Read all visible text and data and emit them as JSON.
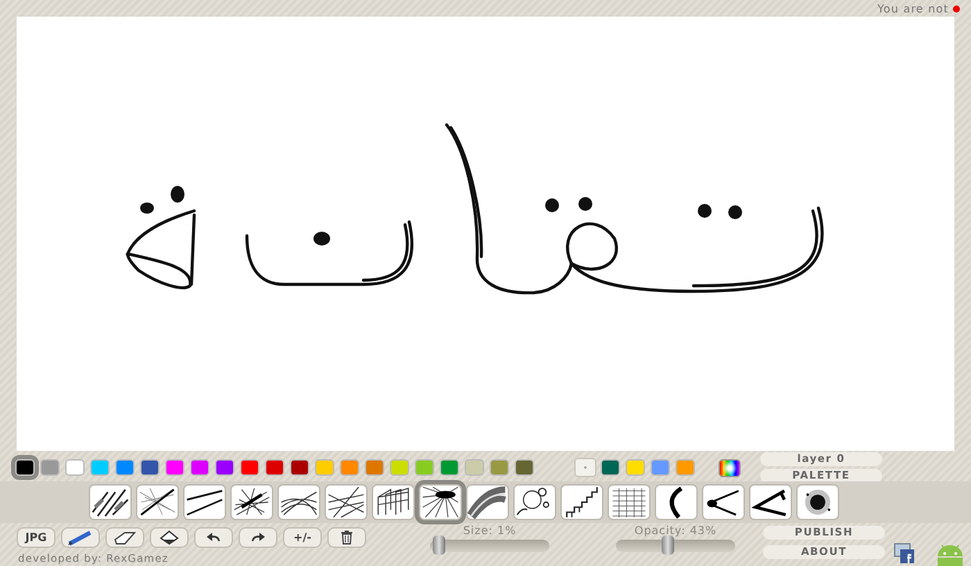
{
  "status": {
    "text": "You are not",
    "signed_in": false
  },
  "palette": {
    "colors": [
      {
        "color": "#000000",
        "selected": true
      },
      {
        "color": "#999999",
        "selected": false
      },
      {
        "color": "#ffffff",
        "selected": false
      },
      {
        "color": "#00ccff",
        "selected": false
      },
      {
        "color": "#0088ff",
        "selected": false
      },
      {
        "color": "#3355aa",
        "selected": false
      },
      {
        "color": "#ff00ff",
        "selected": false
      },
      {
        "color": "#dd00ff",
        "selected": false
      },
      {
        "color": "#9900ff",
        "selected": false
      },
      {
        "color": "#ff0000",
        "selected": false
      },
      {
        "color": "#dd0000",
        "selected": false
      },
      {
        "color": "#aa0000",
        "selected": false
      },
      {
        "color": "#ffcc00",
        "selected": false
      },
      {
        "color": "#ff8800",
        "selected": false
      },
      {
        "color": "#dd7700",
        "selected": false
      },
      {
        "color": "#ccdd00",
        "selected": false
      },
      {
        "color": "#88cc22",
        "selected": false
      },
      {
        "color": "#009933",
        "selected": false
      },
      {
        "color": "#ccccaa",
        "selected": false
      },
      {
        "color": "#999944",
        "selected": false
      },
      {
        "color": "#666633",
        "selected": false
      }
    ],
    "recent_colors": [
      {
        "color": "#006655",
        "selected": false
      },
      {
        "color": "#ffdd00",
        "selected": false
      },
      {
        "color": "#6699ff",
        "selected": false
      },
      {
        "color": "#ff9900",
        "selected": false
      }
    ],
    "layer_button": "layer 0",
    "palette_button": "PALETTE"
  },
  "brushes": [
    {
      "kind": "hatch",
      "selected": false
    },
    {
      "kind": "sketchy",
      "selected": false
    },
    {
      "kind": "lines",
      "selected": false
    },
    {
      "kind": "fur",
      "selected": false
    },
    {
      "kind": "curves",
      "selected": false
    },
    {
      "kind": "web",
      "selected": false
    },
    {
      "kind": "cube",
      "selected": false
    },
    {
      "kind": "radial",
      "selected": true
    },
    {
      "kind": "ribbon",
      "selected": false
    },
    {
      "kind": "circles",
      "selected": false
    },
    {
      "kind": "stairs",
      "selected": false
    },
    {
      "kind": "grid",
      "selected": false
    },
    {
      "kind": "crescent",
      "selected": false
    },
    {
      "kind": "spike",
      "selected": false
    },
    {
      "kind": "chevron",
      "selected": false
    },
    {
      "kind": "spray",
      "selected": false
    }
  ],
  "tools": [
    {
      "kind": "text",
      "label": "JPG"
    },
    {
      "kind": "pencil"
    },
    {
      "kind": "eraser"
    },
    {
      "kind": "fill"
    },
    {
      "kind": "undo"
    },
    {
      "kind": "redo"
    },
    {
      "kind": "text",
      "label": "+/-"
    },
    {
      "kind": "trash"
    }
  ],
  "sliders": [
    {
      "reading": "Size: 1%",
      "level": 0.03
    },
    {
      "reading": "Opacity: 43%",
      "level": 0.43
    }
  ],
  "actions": [
    "PUBLISH",
    "ABOUT"
  ],
  "footer": "developed by: RexGamez"
}
